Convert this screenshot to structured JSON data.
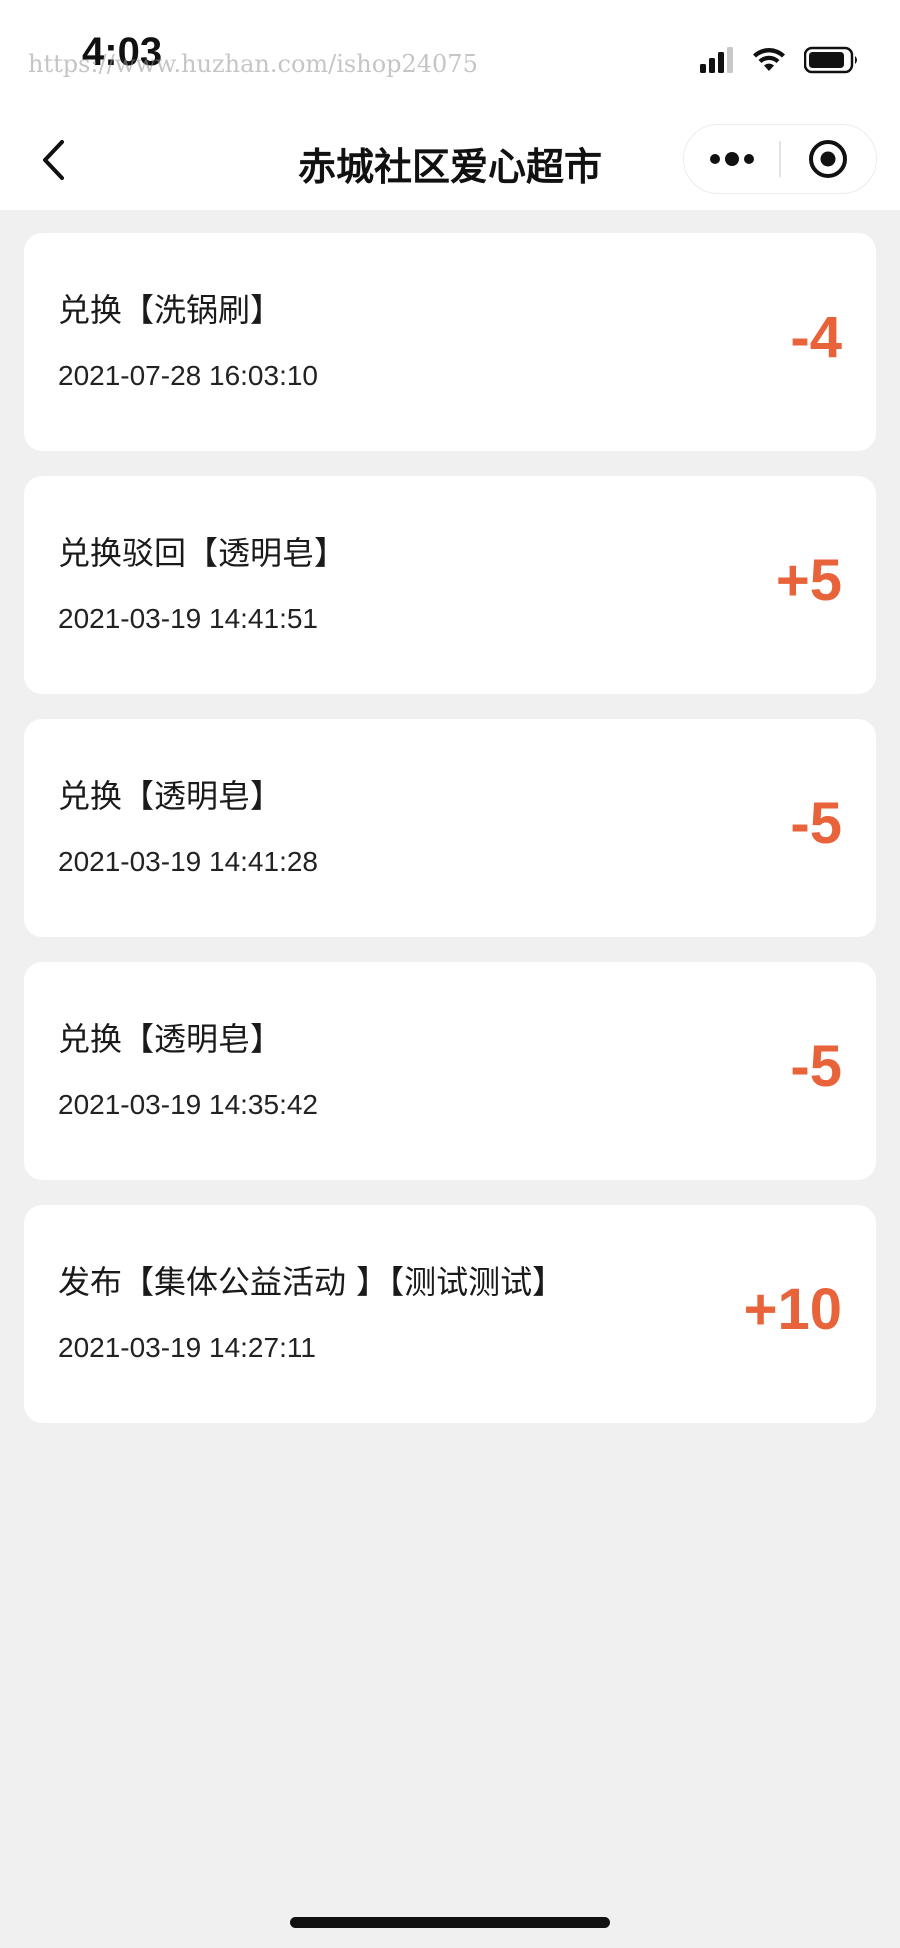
{
  "status_bar": {
    "time": "4:03",
    "watermark": "https://www.huzhan.com/ishop24075"
  },
  "nav": {
    "title": "赤城社区爱心超市"
  },
  "records": [
    {
      "title": "兑换【洗锅刷】",
      "time": "2021-07-28 16:03:10",
      "amount": "-4"
    },
    {
      "title": "兑换驳回【透明皂】",
      "time": "2021-03-19 14:41:51",
      "amount": "+5"
    },
    {
      "title": "兑换【透明皂】",
      "time": "2021-03-19 14:41:28",
      "amount": "-5"
    },
    {
      "title": "兑换【透明皂】",
      "time": "2021-03-19 14:35:42",
      "amount": "-5"
    },
    {
      "title": "发布【集体公益活动 】【测试测试】",
      "time": "2021-03-19 14:27:11",
      "amount": "+10"
    }
  ],
  "colors": {
    "accent": "#e8623a",
    "background": "#f0f0f0",
    "card": "#ffffff"
  },
  "icons": [
    "signal-icon",
    "wifi-icon",
    "battery-icon",
    "back-arrow-icon",
    "more-dots-icon",
    "close-target-icon"
  ]
}
